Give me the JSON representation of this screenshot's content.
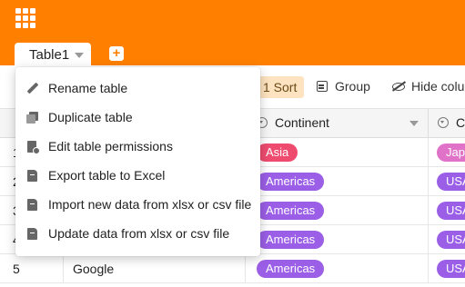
{
  "header": {
    "accent_color": "#ff8000"
  },
  "tabs": [
    {
      "label": "Table1"
    }
  ],
  "toolbar": {
    "sort_label": "1 Sort",
    "group_label": "Group",
    "hide_columns_label": "Hide colu"
  },
  "columns": [
    {
      "label": "Continent"
    },
    {
      "label": "C"
    }
  ],
  "rows": [
    {
      "num": "1",
      "name": "",
      "continent": "Asia",
      "continent_color": "#ee4b6f",
      "country": "Japa",
      "country_color": "#e073c8"
    },
    {
      "num": "2",
      "name": "",
      "continent": "Americas",
      "continent_color": "#9b5ee6",
      "country": "USA",
      "country_color": "#9b5ee6"
    },
    {
      "num": "3",
      "name": "",
      "continent": "Americas",
      "continent_color": "#9b5ee6",
      "country": "USA",
      "country_color": "#9b5ee6"
    },
    {
      "num": "4",
      "name": "",
      "continent": "Americas",
      "continent_color": "#9b5ee6",
      "country": "USA",
      "country_color": "#9b5ee6"
    },
    {
      "num": "5",
      "name": "Google",
      "continent": "Americas",
      "continent_color": "#9b5ee6",
      "country": "USA",
      "country_color": "#9b5ee6"
    }
  ],
  "context_menu": {
    "items": [
      {
        "label": "Rename table",
        "icon": "pencil-icon"
      },
      {
        "label": "Duplicate table",
        "icon": "copy-icon"
      },
      {
        "label": "Edit table permissions",
        "icon": "lock-file-icon"
      },
      {
        "label": "Export table to Excel",
        "icon": "file-icon"
      },
      {
        "label": "Import new data from xlsx or csv file",
        "icon": "file-add-icon"
      },
      {
        "label": "Update data from xlsx or csv file",
        "icon": "file-add-icon"
      }
    ]
  }
}
